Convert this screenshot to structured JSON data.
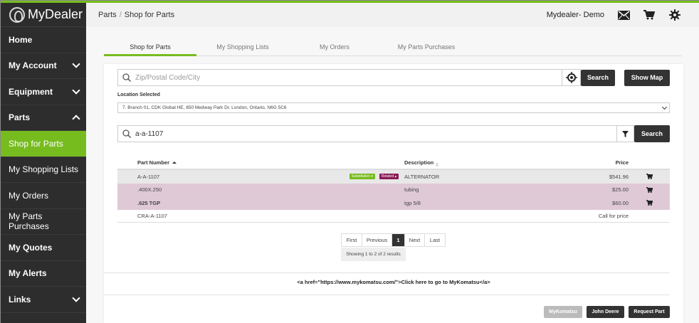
{
  "app": {
    "logo_text": "MyDealer"
  },
  "sidebar": {
    "items": [
      {
        "label": "Home"
      },
      {
        "label": "My Account"
      },
      {
        "label": "Equipment"
      },
      {
        "label": "Parts"
      },
      {
        "label": "Shop for Parts"
      },
      {
        "label": "My Shopping Lists"
      },
      {
        "label": "My Orders"
      },
      {
        "label": "My Parts Purchases"
      },
      {
        "label": "My Quotes"
      },
      {
        "label": "My Alerts"
      },
      {
        "label": "Links"
      }
    ]
  },
  "header": {
    "breadcrumb": [
      "Parts",
      "Shop for Parts"
    ],
    "breadcrumb_sep": "/",
    "user": "Mydealer- Demo"
  },
  "tabs": [
    {
      "label": "Shop for Parts"
    },
    {
      "label": "My Shopping Lists"
    },
    {
      "label": "My Orders"
    },
    {
      "label": "My Parts Purchases"
    }
  ],
  "location": {
    "zip_placeholder": "Zip/Postal Code/City",
    "search_label": "Search",
    "show_map_label": "Show Map",
    "selected_label": "Location Selected",
    "selected_value": "7. Branch 01, CDK Global HE, 850 Medway Park Dr, London, Ontario, N6G 5C6"
  },
  "part_search": {
    "value": "a-a-1107",
    "search_label": "Search"
  },
  "table": {
    "headers": {
      "part_number": "Part Number",
      "description": "Description",
      "price": "Price"
    },
    "badges": {
      "substitution": "Substitution",
      "related": "Related"
    },
    "rows": [
      {
        "part_number": "A-A-1107",
        "description": "ALTERNATOR",
        "price": "$541.96"
      },
      {
        "part_number": ".400X.250",
        "description": "tubing",
        "price": "$25.00"
      },
      {
        "part_number": ".625 TGP",
        "description": "tgp 5/8",
        "price": "$60.00"
      },
      {
        "part_number": "CRA-A-1107",
        "description": "",
        "price": "Call for price"
      }
    ]
  },
  "pagination": {
    "first": "First",
    "previous": "Previous",
    "current": "1",
    "next": "Next",
    "last": "Last",
    "showing": "Showing 1 to 2 of 2 results"
  },
  "footer": {
    "link_text": "<a href=\"https://www.mykomatsu.com/\">Click here to go to MyKomatsu</a>",
    "buttons": {
      "mykomatsu": "MyKomatsu",
      "john_deere": "John Deere",
      "request_part": "Request Part"
    }
  },
  "colors": {
    "accent": "#77bc1f",
    "sidebar": "#2d2d2d",
    "related": "#8a1a55",
    "row_pink": "#dfc9d6"
  }
}
